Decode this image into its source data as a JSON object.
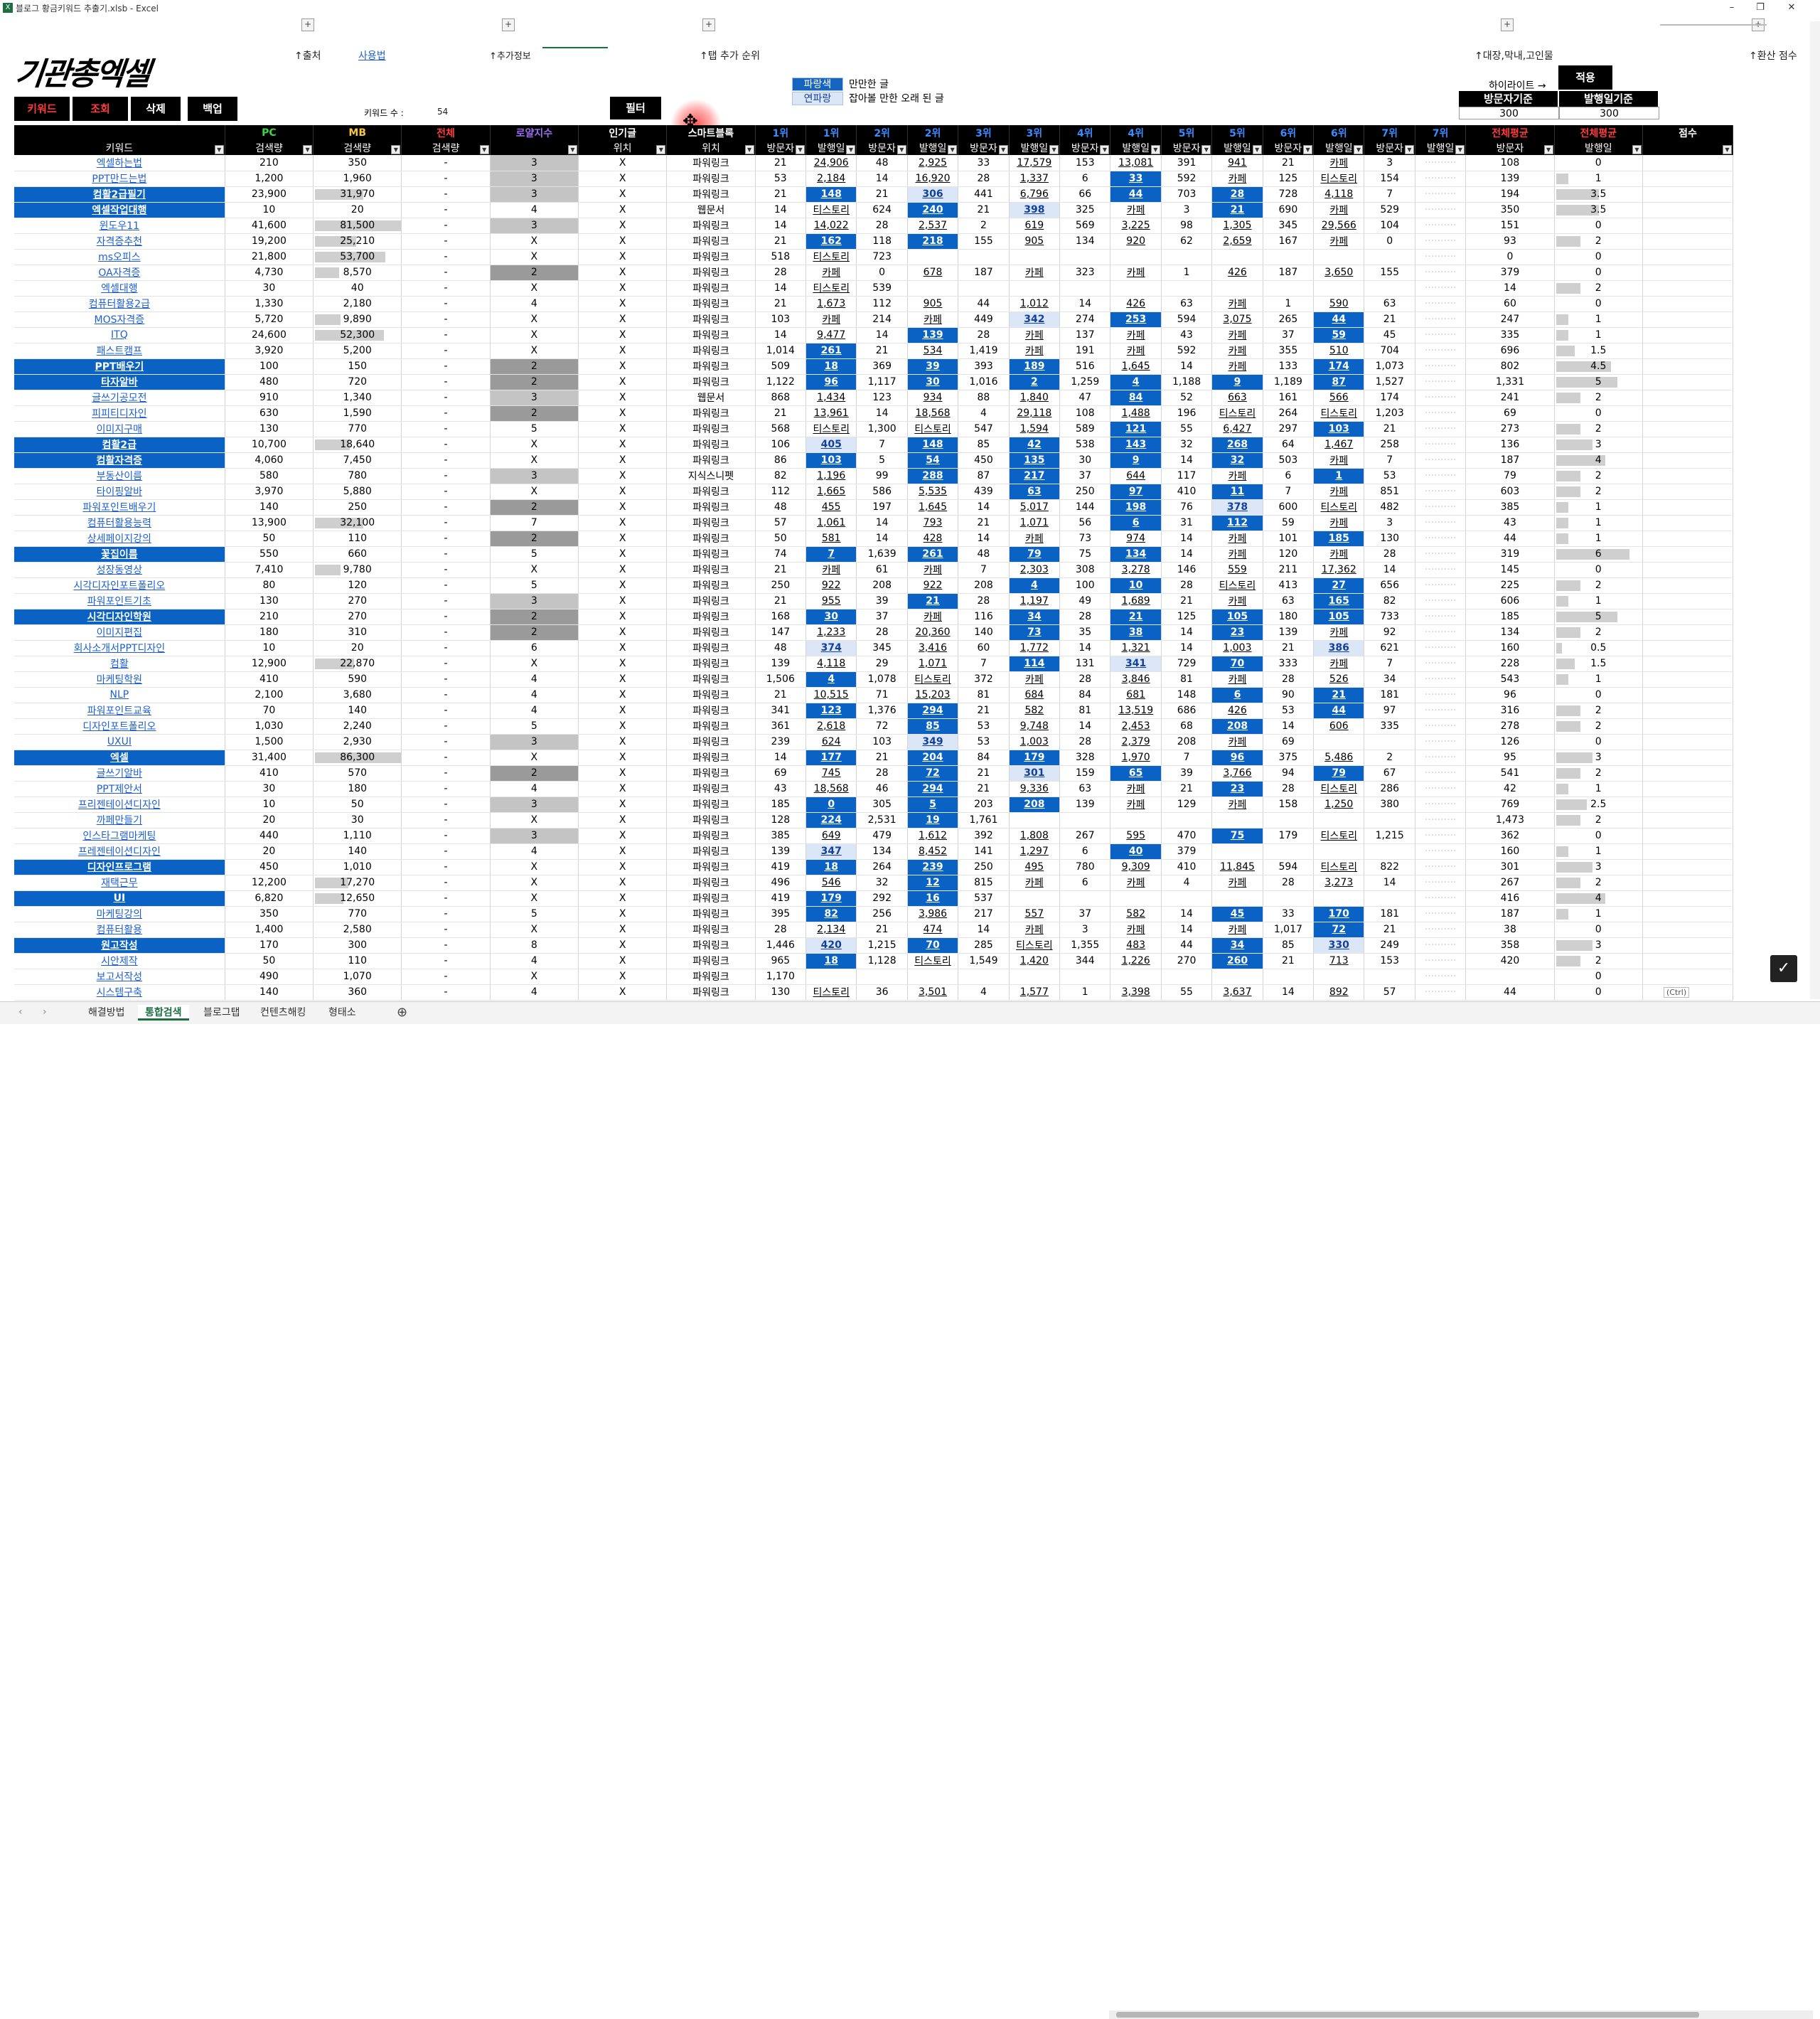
{
  "window": {
    "title": "블로그 황금키워드 추출기.xlsb - Excel"
  },
  "header": {
    "logo": "기관총엑셀",
    "links": [
      "↑출처",
      "사용법",
      "↑추가정보",
      "↑탭 추가 순위",
      "↑대장,막내,고인물",
      "↑환산 점수"
    ]
  },
  "buttons": {
    "keyword": "키워드",
    "lookup": "조회",
    "delete": "삭제",
    "backup": "백업",
    "filter": "필터",
    "apply": "적용"
  },
  "kwcount": {
    "label": "키워드 수 :",
    "value": "54"
  },
  "legend": [
    {
      "swatch": "파랑색",
      "desc": "만만한 글"
    },
    {
      "swatch": "연파랑",
      "desc": "잡아볼 만한 오래 된 글"
    }
  ],
  "highlight_label": "하이라이트 →",
  "criteria": {
    "h1": "방문자기준",
    "h2": "발행일기준",
    "v1": "300",
    "v2": "300"
  },
  "colors": {
    "blue": "#0a63c4",
    "header": "#000000",
    "excel": "#1d6f42"
  },
  "columns": [
    {
      "top": "",
      "sub": "키워드",
      "cls": ""
    },
    {
      "top": "PC",
      "sub": "검색량",
      "cls": "g"
    },
    {
      "top": "MB",
      "sub": "검색량",
      "cls": "y"
    },
    {
      "top": "전체",
      "sub": "검색량",
      "cls": "r"
    },
    {
      "top": "로얄지수",
      "sub": "",
      "cls": "pl"
    },
    {
      "top": "인기글",
      "sub": "위치",
      "cls": ""
    },
    {
      "top": "스마트블록",
      "sub": "위치",
      "cls": ""
    },
    {
      "top": "1위",
      "sub": "방문자",
      "cls": "rn"
    },
    {
      "top": "1위",
      "sub": "발행일",
      "cls": "rn"
    },
    {
      "top": "2위",
      "sub": "방문자",
      "cls": "rn"
    },
    {
      "top": "2위",
      "sub": "발행일",
      "cls": "rn"
    },
    {
      "top": "3위",
      "sub": "방문자",
      "cls": "rn"
    },
    {
      "top": "3위",
      "sub": "발행일",
      "cls": "rn"
    },
    {
      "top": "4위",
      "sub": "방문자",
      "cls": "rn"
    },
    {
      "top": "4위",
      "sub": "발행일",
      "cls": "rn"
    },
    {
      "top": "5위",
      "sub": "방문자",
      "cls": "rn"
    },
    {
      "top": "5위",
      "sub": "발행일",
      "cls": "rn"
    },
    {
      "top": "6위",
      "sub": "방문자",
      "cls": "rn"
    },
    {
      "top": "6위",
      "sub": "발행일",
      "cls": "rn"
    },
    {
      "top": "7위",
      "sub": "방문자",
      "cls": "rn"
    },
    {
      "top": "7위",
      "sub": "발행일",
      "cls": "rn"
    },
    {
      "top": "전체평균",
      "sub": "방문자",
      "cls": "r"
    },
    {
      "top": "전체평균",
      "sub": "발행일",
      "cls": "r"
    },
    {
      "top": "점수",
      "sub": "",
      "cls": ""
    }
  ],
  "rows": [
    [
      "엑셀하는법",
      "210",
      "350",
      "-",
      "3",
      "X",
      "파워링크",
      "21",
      "24,906",
      "48",
      "2,925",
      "33",
      "17,579",
      "153",
      "13,081",
      "391",
      "941",
      "21",
      "카페",
      "3",
      "",
      "108",
      "0"
    ],
    [
      "PPT만드는법",
      "1,200",
      "1,960",
      "-",
      "3",
      "X",
      "파워링크",
      "53",
      "2,184",
      "14",
      "16,920",
      "28",
      "1,337",
      "6",
      "33",
      "592",
      "카페",
      "125",
      "티스토리",
      "154",
      "",
      "139",
      "1"
    ],
    [
      "컴활2급필기",
      "23,900",
      "31,970",
      "-",
      "3",
      "X",
      "파워링크",
      "21",
      "148",
      "21",
      "306",
      "441",
      "6,796",
      "66",
      "44",
      "703",
      "28",
      "728",
      "4,118",
      "7",
      "",
      "194",
      "3.5"
    ],
    [
      "엑셀작업대행",
      "10",
      "20",
      "-",
      "4",
      "X",
      "웹문서",
      "14",
      "티스토리",
      "624",
      "240",
      "21",
      "398",
      "325",
      "카페",
      "3",
      "21",
      "690",
      "카페",
      "529",
      "",
      "350",
      "3.5"
    ],
    [
      "윈도우11",
      "41,600",
      "81,500",
      "-",
      "3",
      "X",
      "파워링크",
      "14",
      "14,022",
      "28",
      "2,537",
      "2",
      "619",
      "569",
      "3,225",
      "98",
      "1,305",
      "345",
      "29,566",
      "104",
      "",
      "151",
      "0"
    ],
    [
      "자격증추천",
      "19,200",
      "25,210",
      "-",
      "X",
      "X",
      "파워링크",
      "21",
      "162",
      "118",
      "218",
      "155",
      "905",
      "134",
      "920",
      "62",
      "2,659",
      "167",
      "카페",
      "0",
      "",
      "93",
      "2"
    ],
    [
      "ms오피스",
      "21,800",
      "53,700",
      "-",
      "X",
      "X",
      "파워링크",
      "518",
      "티스토리",
      "723",
      "",
      "",
      "",
      "",
      "",
      "",
      "",
      "",
      "",
      "",
      "",
      "0",
      "0"
    ],
    [
      "OA자격증",
      "4,730",
      "8,570",
      "-",
      "2",
      "X",
      "파워링크",
      "28",
      "카페",
      "0",
      "678",
      "187",
      "카페",
      "323",
      "카페",
      "1",
      "426",
      "187",
      "3,650",
      "155",
      "",
      "379",
      "0"
    ],
    [
      "엑셀대행",
      "30",
      "40",
      "-",
      "X",
      "X",
      "파워링크",
      "14",
      "티스토리",
      "539",
      "",
      "",
      "",
      "",
      "",
      "",
      "",
      "",
      "",
      "",
      "",
      "14",
      "2"
    ],
    [
      "컴퓨터활용2급",
      "1,330",
      "2,180",
      "-",
      "4",
      "X",
      "파워링크",
      "21",
      "1,673",
      "112",
      "905",
      "44",
      "1,012",
      "14",
      "426",
      "63",
      "카페",
      "1",
      "590",
      "63",
      "",
      "60",
      "0"
    ],
    [
      "MOS자격증",
      "5,720",
      "9,890",
      "-",
      "X",
      "X",
      "파워링크",
      "103",
      "카페",
      "214",
      "카페",
      "449",
      "342",
      "274",
      "253",
      "594",
      "3,075",
      "265",
      "44",
      "21",
      "",
      "247",
      "1"
    ],
    [
      "ITQ",
      "24,600",
      "52,300",
      "-",
      "X",
      "X",
      "파워링크",
      "14",
      "9,477",
      "14",
      "139",
      "28",
      "카페",
      "137",
      "카페",
      "43",
      "카페",
      "37",
      "59",
      "45",
      "",
      "335",
      "1"
    ],
    [
      "패스트캠프",
      "3,920",
      "5,200",
      "-",
      "X",
      "X",
      "파워링크",
      "1,014",
      "261",
      "21",
      "534",
      "1,419",
      "카페",
      "191",
      "카페",
      "592",
      "카페",
      "355",
      "510",
      "704",
      "",
      "696",
      "1.5"
    ],
    [
      "PPT배우기",
      "100",
      "150",
      "-",
      "2",
      "X",
      "파워링크",
      "509",
      "18",
      "369",
      "39",
      "393",
      "189",
      "516",
      "1,645",
      "14",
      "카페",
      "133",
      "174",
      "1,073",
      "",
      "802",
      "4.5"
    ],
    [
      "타자알바",
      "480",
      "720",
      "-",
      "2",
      "X",
      "파워링크",
      "1,122",
      "96",
      "1,117",
      "30",
      "1,016",
      "2",
      "1,259",
      "4",
      "1,188",
      "9",
      "1,189",
      "87",
      "1,527",
      "",
      "1,331",
      "5"
    ],
    [
      "글쓰기공모전",
      "910",
      "1,340",
      "-",
      "3",
      "X",
      "웹문서",
      "868",
      "1,434",
      "123",
      "934",
      "88",
      "1,840",
      "47",
      "84",
      "52",
      "663",
      "161",
      "566",
      "174",
      "",
      "241",
      "2"
    ],
    [
      "피피티디자인",
      "630",
      "1,590",
      "-",
      "2",
      "X",
      "파워링크",
      "21",
      "13,961",
      "14",
      "18,568",
      "4",
      "29,118",
      "108",
      "1,488",
      "196",
      "티스토리",
      "264",
      "티스토리",
      "1,203",
      "",
      "69",
      "0"
    ],
    [
      "이미지구매",
      "130",
      "770",
      "-",
      "5",
      "X",
      "파워링크",
      "568",
      "티스토리",
      "1,300",
      "티스토리",
      "547",
      "1,594",
      "589",
      "121",
      "55",
      "6,427",
      "297",
      "103",
      "21",
      "",
      "273",
      "2"
    ],
    [
      "컴활2급",
      "10,700",
      "18,640",
      "-",
      "X",
      "X",
      "파워링크",
      "106",
      "405",
      "7",
      "148",
      "85",
      "42",
      "538",
      "143",
      "32",
      "268",
      "64",
      "1,467",
      "258",
      "",
      "136",
      "3"
    ],
    [
      "컴활자격증",
      "4,060",
      "7,450",
      "-",
      "X",
      "X",
      "파워링크",
      "86",
      "103",
      "5",
      "54",
      "450",
      "135",
      "30",
      "9",
      "14",
      "32",
      "503",
      "카페",
      "7",
      "",
      "187",
      "4"
    ],
    [
      "부동산이름",
      "580",
      "780",
      "-",
      "3",
      "X",
      "지식스니펫",
      "82",
      "1,196",
      "99",
      "288",
      "87",
      "217",
      "37",
      "644",
      "117",
      "카페",
      "6",
      "1",
      "53",
      "",
      "79",
      "2"
    ],
    [
      "타이핑알바",
      "3,970",
      "5,880",
      "-",
      "X",
      "X",
      "파워링크",
      "112",
      "1,665",
      "586",
      "5,535",
      "439",
      "63",
      "250",
      "97",
      "410",
      "11",
      "7",
      "카페",
      "851",
      "",
      "603",
      "2"
    ],
    [
      "파워포인트배우기",
      "140",
      "250",
      "-",
      "2",
      "X",
      "파워링크",
      "48",
      "455",
      "197",
      "1,645",
      "14",
      "5,017",
      "144",
      "198",
      "76",
      "378",
      "600",
      "티스토리",
      "482",
      "",
      "385",
      "1"
    ],
    [
      "컴퓨터활용능력",
      "13,900",
      "32,100",
      "-",
      "7",
      "X",
      "파워링크",
      "57",
      "1,061",
      "14",
      "793",
      "21",
      "1,071",
      "56",
      "6",
      "31",
      "112",
      "59",
      "카페",
      "3",
      "",
      "43",
      "1"
    ],
    [
      "상세페이지강의",
      "50",
      "110",
      "-",
      "2",
      "X",
      "파워링크",
      "50",
      "581",
      "14",
      "428",
      "14",
      "카페",
      "73",
      "974",
      "14",
      "카페",
      "101",
      "185",
      "130",
      "",
      "44",
      "1"
    ],
    [
      "꽃집이름",
      "550",
      "660",
      "-",
      "5",
      "X",
      "파워링크",
      "74",
      "7",
      "1,639",
      "261",
      "48",
      "79",
      "75",
      "134",
      "14",
      "카페",
      "120",
      "카페",
      "28",
      "",
      "319",
      "6"
    ],
    [
      "성장동영상",
      "7,410",
      "9,780",
      "-",
      "X",
      "X",
      "파워링크",
      "21",
      "카페",
      "61",
      "카페",
      "7",
      "2,303",
      "308",
      "3,278",
      "146",
      "559",
      "211",
      "17,362",
      "14",
      "",
      "145",
      "0"
    ],
    [
      "시각디자인포트폴리오",
      "80",
      "120",
      "-",
      "5",
      "X",
      "파워링크",
      "250",
      "922",
      "208",
      "922",
      "208",
      "4",
      "100",
      "10",
      "28",
      "티스토리",
      "413",
      "27",
      "656",
      "",
      "225",
      "2"
    ],
    [
      "파워포인트기초",
      "130",
      "270",
      "-",
      "3",
      "X",
      "파워링크",
      "21",
      "955",
      "39",
      "21",
      "28",
      "1,197",
      "49",
      "1,689",
      "21",
      "카페",
      "63",
      "165",
      "82",
      "",
      "606",
      "1"
    ],
    [
      "시각디자인학원",
      "210",
      "270",
      "-",
      "2",
      "X",
      "파워링크",
      "168",
      "30",
      "37",
      "카페",
      "116",
      "34",
      "28",
      "21",
      "125",
      "105",
      "180",
      "105",
      "733",
      "",
      "185",
      "5"
    ],
    [
      "이미지편집",
      "180",
      "310",
      "-",
      "2",
      "X",
      "파워링크",
      "147",
      "1,233",
      "28",
      "20,360",
      "140",
      "73",
      "35",
      "38",
      "14",
      "23",
      "139",
      "카페",
      "92",
      "",
      "134",
      "2"
    ],
    [
      "회사소개서PPT디자인",
      "10",
      "20",
      "-",
      "6",
      "X",
      "파워링크",
      "48",
      "374",
      "345",
      "3,416",
      "60",
      "1,772",
      "14",
      "1,321",
      "14",
      "1,003",
      "21",
      "386",
      "621",
      "",
      "160",
      "0.5"
    ],
    [
      "컴활",
      "12,900",
      "22,870",
      "-",
      "X",
      "X",
      "파워링크",
      "139",
      "4,118",
      "29",
      "1,071",
      "7",
      "114",
      "131",
      "341",
      "729",
      "70",
      "333",
      "카페",
      "7",
      "",
      "228",
      "1.5"
    ],
    [
      "마케팅학원",
      "410",
      "590",
      "-",
      "4",
      "X",
      "파워링크",
      "1,506",
      "4",
      "1,078",
      "티스토리",
      "372",
      "카페",
      "28",
      "3,846",
      "81",
      "카페",
      "28",
      "526",
      "34",
      "",
      "543",
      "1"
    ],
    [
      "NLP",
      "2,100",
      "3,680",
      "-",
      "4",
      "X",
      "파워링크",
      "21",
      "10,515",
      "71",
      "15,203",
      "81",
      "684",
      "84",
      "681",
      "148",
      "6",
      "90",
      "21",
      "181",
      "",
      "96",
      "0"
    ],
    [
      "파워포인트교육",
      "70",
      "140",
      "-",
      "4",
      "X",
      "파워링크",
      "341",
      "123",
      "1,376",
      "294",
      "21",
      "582",
      "81",
      "13,519",
      "686",
      "426",
      "53",
      "44",
      "97",
      "",
      "316",
      "2"
    ],
    [
      "디자인포트폴리오",
      "1,030",
      "2,240",
      "-",
      "5",
      "X",
      "파워링크",
      "361",
      "2,618",
      "72",
      "85",
      "53",
      "9,748",
      "14",
      "2,453",
      "68",
      "208",
      "14",
      "606",
      "335",
      "",
      "278",
      "2"
    ],
    [
      "UXUI",
      "1,500",
      "2,930",
      "-",
      "3",
      "X",
      "파워링크",
      "239",
      "624",
      "103",
      "349",
      "53",
      "1,003",
      "28",
      "2,379",
      "208",
      "카페",
      "69",
      "",
      "",
      "",
      "126",
      "0"
    ],
    [
      "엑셀",
      "31,400",
      "86,300",
      "-",
      "X",
      "X",
      "파워링크",
      "14",
      "177",
      "21",
      "204",
      "84",
      "179",
      "328",
      "1,970",
      "7",
      "96",
      "375",
      "5,486",
      "2",
      "",
      "95",
      "3"
    ],
    [
      "글쓰기알바",
      "410",
      "570",
      "-",
      "2",
      "X",
      "파워링크",
      "69",
      "745",
      "28",
      "72",
      "21",
      "301",
      "159",
      "65",
      "39",
      "3,766",
      "94",
      "79",
      "67",
      "",
      "541",
      "2"
    ],
    [
      "PPT제안서",
      "30",
      "180",
      "-",
      "4",
      "X",
      "파워링크",
      "43",
      "18,568",
      "46",
      "294",
      "21",
      "9,336",
      "63",
      "카페",
      "21",
      "23",
      "28",
      "티스토리",
      "286",
      "",
      "42",
      "1"
    ],
    [
      "프리젠테이션디자인",
      "10",
      "50",
      "-",
      "3",
      "X",
      "파워링크",
      "185",
      "0",
      "305",
      "5",
      "203",
      "208",
      "139",
      "카페",
      "129",
      "카페",
      "158",
      "1,250",
      "380",
      "",
      "769",
      "2.5"
    ],
    [
      "까페만들기",
      "20",
      "30",
      "-",
      "X",
      "X",
      "파워링크",
      "128",
      "224",
      "2,531",
      "19",
      "1,761",
      "",
      "",
      "",
      "",
      "",
      "",
      "",
      "",
      "",
      "1,473",
      "2"
    ],
    [
      "인스타그램마케팅",
      "440",
      "1,110",
      "-",
      "3",
      "X",
      "파워링크",
      "385",
      "649",
      "479",
      "1,612",
      "392",
      "1,808",
      "267",
      "595",
      "470",
      "75",
      "179",
      "티스토리",
      "1,215",
      "",
      "362",
      "0"
    ],
    [
      "프레젠테이션디자인",
      "20",
      "140",
      "-",
      "4",
      "X",
      "파워링크",
      "139",
      "347",
      "134",
      "8,452",
      "141",
      "1,297",
      "6",
      "40",
      "379",
      "",
      "",
      "",
      "",
      "",
      "160",
      "1"
    ],
    [
      "디자인프로그램",
      "450",
      "1,010",
      "-",
      "X",
      "X",
      "파워링크",
      "419",
      "18",
      "264",
      "239",
      "250",
      "495",
      "780",
      "9,309",
      "410",
      "11,845",
      "594",
      "티스토리",
      "822",
      "",
      "301",
      "3"
    ],
    [
      "재택근무",
      "12,200",
      "17,270",
      "-",
      "X",
      "X",
      "파워링크",
      "496",
      "546",
      "32",
      "12",
      "815",
      "카페",
      "6",
      "카페",
      "4",
      "카페",
      "28",
      "3,273",
      "14",
      "",
      "267",
      "2"
    ],
    [
      "UI",
      "6,820",
      "12,650",
      "-",
      "X",
      "X",
      "파워링크",
      "419",
      "179",
      "292",
      "16",
      "537",
      "",
      "",
      "",
      "",
      "",
      "",
      "",
      "",
      "",
      "416",
      "4"
    ],
    [
      "마케팅강의",
      "350",
      "770",
      "-",
      "5",
      "X",
      "파워링크",
      "395",
      "82",
      "256",
      "3,986",
      "217",
      "557",
      "37",
      "582",
      "14",
      "45",
      "33",
      "170",
      "181",
      "",
      "187",
      "1"
    ],
    [
      "컴퓨터활용",
      "1,400",
      "2,580",
      "-",
      "X",
      "X",
      "파워링크",
      "28",
      "2,134",
      "21",
      "474",
      "14",
      "카페",
      "3",
      "카페",
      "14",
      "카페",
      "1,017",
      "72",
      "21",
      "",
      "38",
      "0"
    ],
    [
      "원고작성",
      "170",
      "300",
      "-",
      "8",
      "X",
      "파워링크",
      "1,446",
      "420",
      "1,215",
      "70",
      "285",
      "티스토리",
      "1,355",
      "483",
      "44",
      "34",
      "85",
      "330",
      "249",
      "",
      "358",
      "3"
    ],
    [
      "시안제작",
      "50",
      "110",
      "-",
      "4",
      "X",
      "파워링크",
      "965",
      "18",
      "1,128",
      "티스토리",
      "1,549",
      "1,420",
      "344",
      "1,226",
      "270",
      "260",
      "21",
      "713",
      "153",
      "",
      "420",
      "2"
    ],
    [
      "보고서작성",
      "490",
      "1,070",
      "-",
      "X",
      "X",
      "파워링크",
      "1,170",
      "",
      "",
      "",
      "",
      "",
      "",
      "",
      "",
      "",
      "",
      "",
      "",
      "",
      "",
      "0"
    ],
    [
      "시스템구축",
      "140",
      "360",
      "-",
      "4",
      "X",
      "파워링크",
      "130",
      "티스토리",
      "36",
      "3,501",
      "4",
      "1,577",
      "1",
      "3,398",
      "55",
      "3,637",
      "14",
      "892",
      "57",
      "",
      "44",
      "0"
    ]
  ],
  "sheet_tabs": [
    "해결방법",
    "통합검색",
    "블로그탭",
    "컨텐츠해킹",
    "형태소"
  ],
  "active_tab": "통합검색",
  "paste_label": "(Ctrl)"
}
